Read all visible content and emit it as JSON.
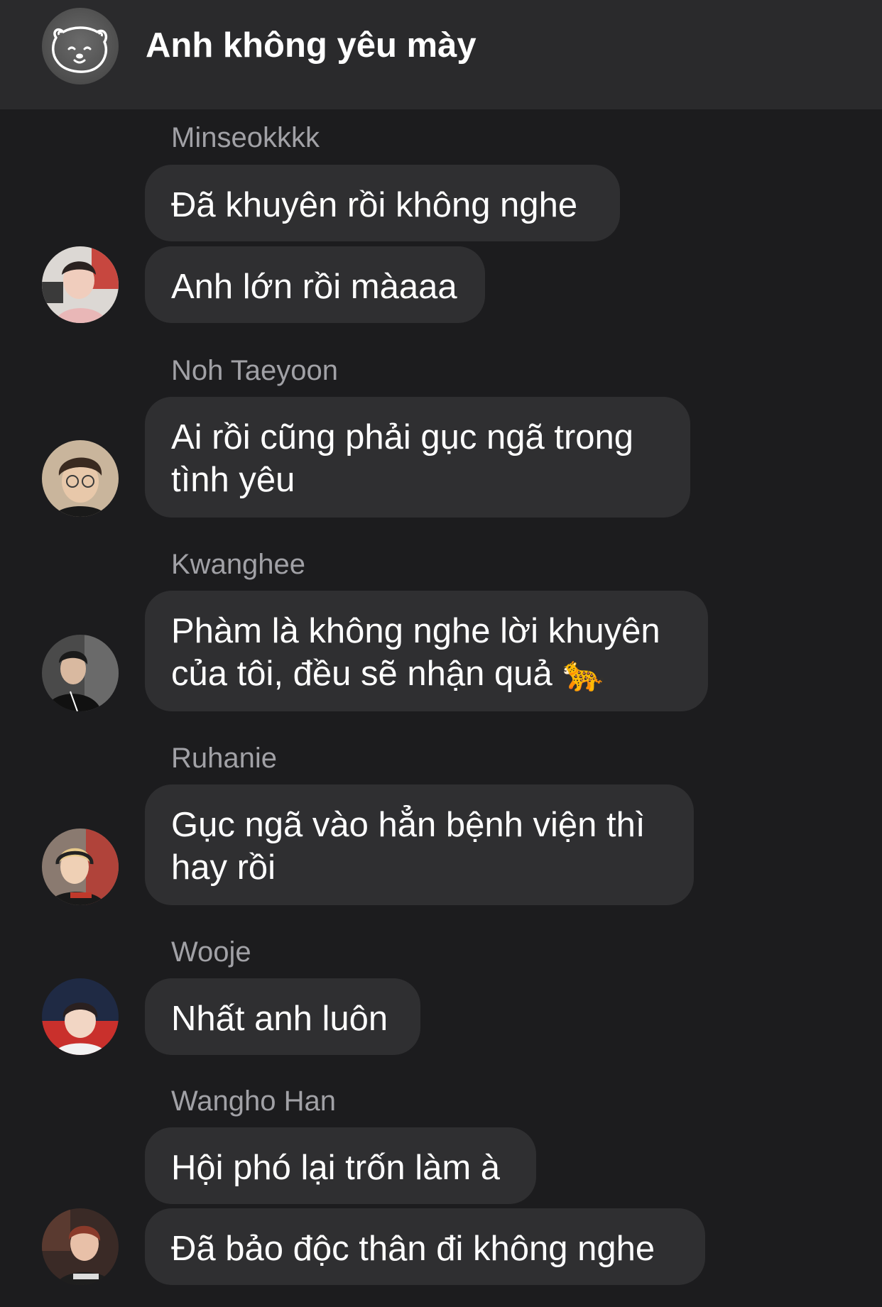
{
  "header": {
    "title": "Anh không yêu mày",
    "group_avatar_icon": "bear-icon"
  },
  "messages": [
    {
      "sender": "Minseokkkk",
      "bubbles": [
        "Đã khuyên rồi không nghe",
        "Anh lớn rồi màaaa"
      ]
    },
    {
      "sender": "Noh Taeyoon",
      "bubbles": [
        "Ai rồi cũng phải gục ngã trong\ntình yêu"
      ]
    },
    {
      "sender": "Kwanghee",
      "bubbles": [
        "Phàm là không nghe lời khuyên\ncủa tôi, đều sẽ nhận quả 🐆"
      ]
    },
    {
      "sender": "Ruhanie",
      "bubbles": [
        "Gục ngã vào hẳn bệnh viện thì\nhay rồi"
      ]
    },
    {
      "sender": "Wooje",
      "bubbles": [
        "Nhất anh luôn"
      ]
    },
    {
      "sender": "Wangho Han",
      "bubbles": [
        "Hội phó lại trốn làm à",
        "Đã bảo độc thân đi không nghe"
      ]
    }
  ],
  "colors": {
    "background": "#1c1c1e",
    "header": "#2a2a2c",
    "bubble": "#2f2f31",
    "sender_name": "#a1a1a6"
  }
}
